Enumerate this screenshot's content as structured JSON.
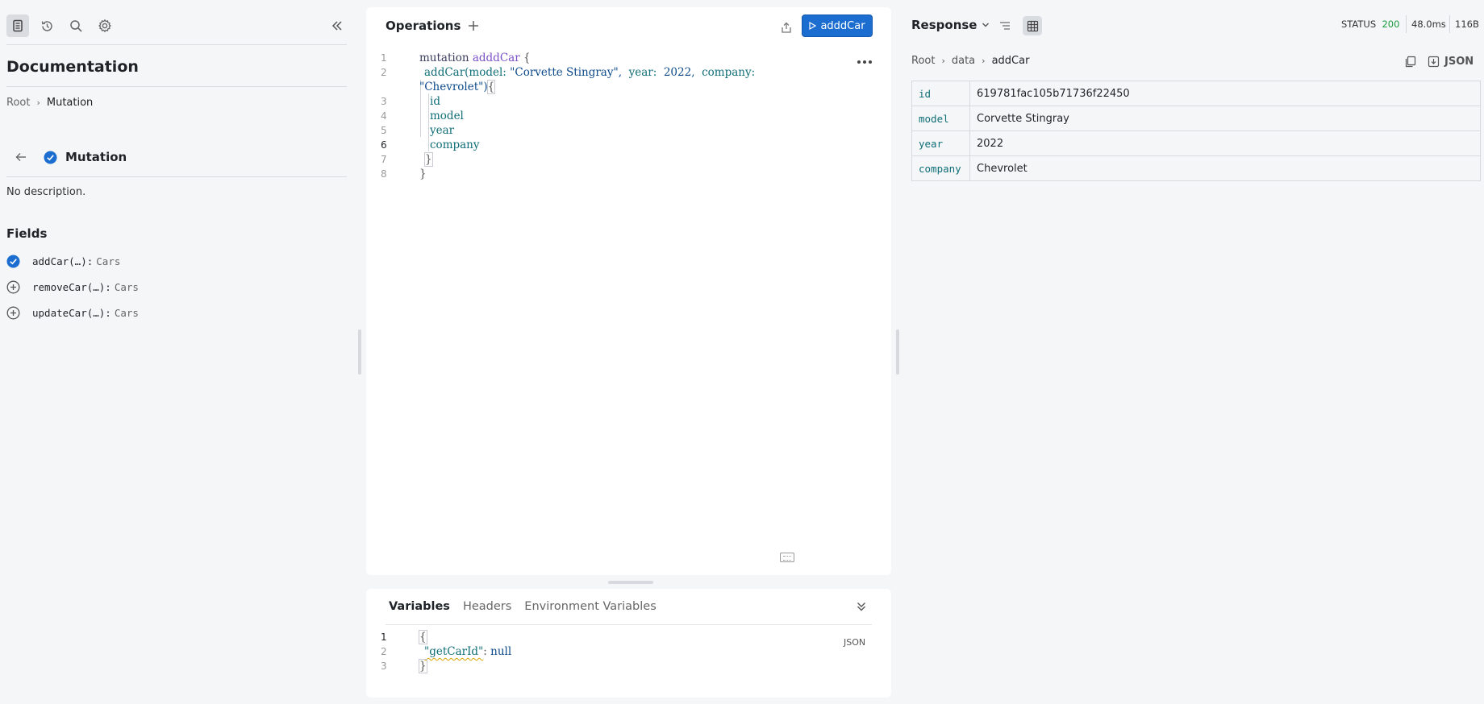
{
  "sidebar": {
    "title": "Documentation",
    "breadcrumb": {
      "root": "Root",
      "current": "Mutation"
    },
    "type_name": "Mutation",
    "description": "No description.",
    "fields_title": "Fields",
    "fields": [
      {
        "name": "addCar(…):",
        "type": "Cars",
        "selected": true
      },
      {
        "name": "removeCar(…):",
        "type": "Cars",
        "selected": false
      },
      {
        "name": "updateCar(…):",
        "type": "Cars",
        "selected": false
      }
    ],
    "toolbar_icons": [
      "document-icon",
      "history-icon",
      "search-icon",
      "gear-icon",
      "collapse-icon"
    ]
  },
  "editor": {
    "title": "Operations",
    "run_label": "adddCar",
    "line_numbers": [
      "1",
      "2",
      "3",
      "4",
      "5",
      "6",
      "7",
      "8"
    ],
    "code": {
      "l1_kw": "mutation",
      "l1_name": "adddCar",
      "l1_brace": "{",
      "l2_field": "addCar(model:",
      "l2_model": "\"Corvette Stingray\",",
      "l2_year_key": "year:",
      "l2_year": "2022,",
      "l2_company_key": "company:",
      "l2b_company": "\"Chevrolet\")",
      "l2b_brace": "{",
      "l3": "id",
      "l4": "model",
      "l5": "year",
      "l6": "company",
      "l7": "}",
      "l8": "}"
    }
  },
  "variables": {
    "tabs": [
      "Variables",
      "Headers",
      "Environment Variables"
    ],
    "json_label": "JSON",
    "line_numbers": [
      "1",
      "2",
      "3"
    ],
    "code": {
      "open": "{",
      "key": "\"getCarId\"",
      "colon": ":",
      "value": "null",
      "close": "}"
    }
  },
  "response": {
    "title": "Response",
    "status_label": "STATUS",
    "status_code": "200",
    "time": "48.0ms",
    "size": "116B",
    "breadcrumb": [
      "Root",
      "data",
      "addCar"
    ],
    "json_label": "JSON",
    "rows": [
      {
        "key": "id",
        "value": "619781fac105b71736f22450"
      },
      {
        "key": "model",
        "value": "Corvette Stingray"
      },
      {
        "key": "year",
        "value": "2022"
      },
      {
        "key": "company",
        "value": "Chevrolet"
      }
    ]
  },
  "colors": {
    "accent": "#1c6dd0",
    "status_ok": "#1a9b3c",
    "field_key": "#0f6e76",
    "operation_name": "#7a4fc7"
  }
}
